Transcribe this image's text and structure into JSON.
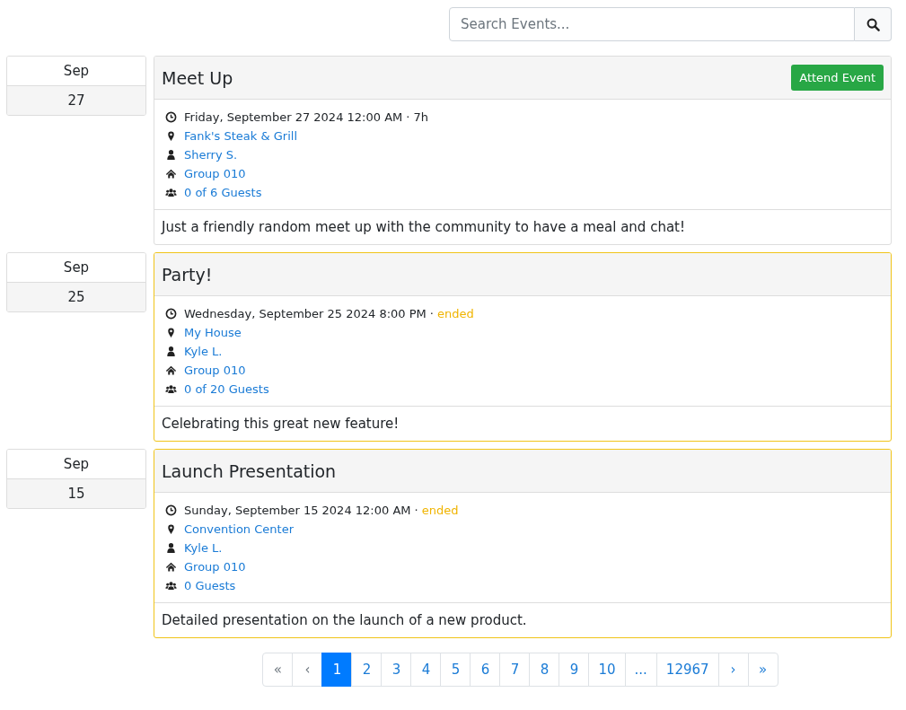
{
  "search": {
    "placeholder": "Search Events..."
  },
  "events": [
    {
      "month": "Sep",
      "day": "27",
      "title": "Meet Up",
      "attend_button": "Attend Event",
      "ended": false,
      "when": "Friday, September 27 2024 12:00 AM",
      "status": {
        "kind": "duration",
        "separator": "·",
        "text": "7h"
      },
      "location": "Fank's Steak & Grill",
      "host": "Sherry S.",
      "group": "Group 010",
      "guests": "0 of 6 Guests",
      "description": "Just a friendly random meet up with the community to have a meal and chat!"
    },
    {
      "month": "Sep",
      "day": "25",
      "title": "Party!",
      "ended": true,
      "when": "Wednesday, September 25 2024 8:00 PM",
      "status": {
        "kind": "ended",
        "separator": "·",
        "text": "ended"
      },
      "location": "My House",
      "host": "Kyle L.",
      "group": "Group 010",
      "guests": "0 of 20 Guests",
      "description": "Celebrating this great new feature!"
    },
    {
      "month": "Sep",
      "day": "15",
      "title": "Launch Presentation",
      "ended": true,
      "when": "Sunday, September 15 2024 12:00 AM",
      "status": {
        "kind": "ended",
        "separator": "·",
        "text": "ended"
      },
      "location": "Convention Center",
      "host": "Kyle L.",
      "group": "Group 010",
      "guests": "0 Guests",
      "description": "Detailed presentation on the launch of a new product."
    }
  ],
  "pagination": [
    {
      "label": "«",
      "selected": false,
      "disabled": true
    },
    {
      "label": "‹",
      "selected": false,
      "disabled": true
    },
    {
      "label": "1",
      "selected": true,
      "disabled": false
    },
    {
      "label": "2",
      "selected": false,
      "disabled": false
    },
    {
      "label": "3",
      "selected": false,
      "disabled": false
    },
    {
      "label": "4",
      "selected": false,
      "disabled": false
    },
    {
      "label": "5",
      "selected": false,
      "disabled": false
    },
    {
      "label": "6",
      "selected": false,
      "disabled": false
    },
    {
      "label": "7",
      "selected": false,
      "disabled": false
    },
    {
      "label": "8",
      "selected": false,
      "disabled": false
    },
    {
      "label": "9",
      "selected": false,
      "disabled": false
    },
    {
      "label": "10",
      "selected": false,
      "disabled": false
    },
    {
      "label": "...",
      "selected": false,
      "disabled": false
    },
    {
      "label": "12967",
      "selected": false,
      "disabled": false
    },
    {
      "label": "›",
      "selected": false,
      "disabled": false
    },
    {
      "label": "»",
      "selected": false,
      "disabled": false
    }
  ]
}
